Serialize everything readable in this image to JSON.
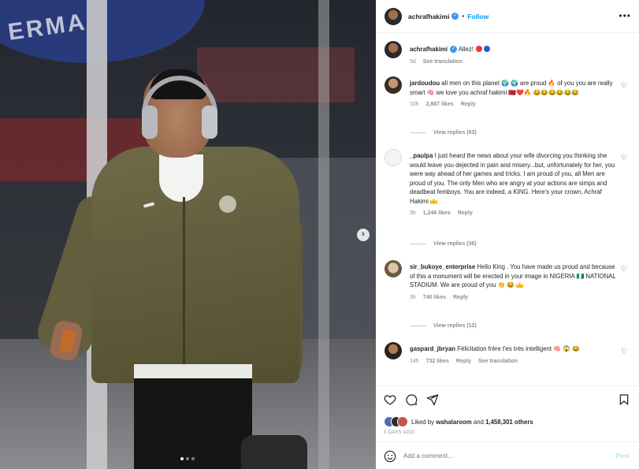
{
  "post": {
    "username": "achrafhakimi",
    "follow_label": "Follow",
    "more_label": "•••",
    "caption_user": "achrafhakimi",
    "caption_text": "Allez!",
    "caption_time": "5d",
    "caption_translate": "See translation"
  },
  "comments": [
    {
      "user": "jardoudou",
      "text": "all men on this planet 🌍 🌍 are proud 🔥 of you you are really smart 🧠 we love you achraf hakimi 🇲🇦❤️🔥 😂😂😂😂😂😂",
      "time": "10h",
      "likes": "2,887 likes",
      "reply": "Reply",
      "view_replies": "View replies (63)"
    },
    {
      "user": "_paulpa",
      "text": "I just heard the news about your wife divorcing you thinking she would leave you dejected in pain and misery...but, unfortunately for her, you were way ahead of her games and tricks. I am proud of you, all Men are proud of you. The only Men who are angry at your actions are simps and deadbeat femboys. You are indeed, a KING. Here's your crown, Achraf Hakimi",
      "time": "3h",
      "likes": "1,246 likes",
      "reply": "Reply",
      "view_replies": "View replies (36)"
    },
    {
      "user": "sir_bukoye_enterprise",
      "text": "Hello King . You have made us proud and because of this a monument will be erected in your image in NIGERIA 🇳🇬 NATIONAL STADIUM. We are proud of you 👏 😂",
      "time": "3h",
      "likes": "740 likes",
      "reply": "Reply",
      "view_replies": "View replies (12)"
    },
    {
      "user": "gaspard_jbryan",
      "text": "Félicitation frère t'es très intelligent 🧠 😱 😂",
      "time": "14h",
      "likes": "732 likes",
      "reply": "Reply",
      "translate": "See translation"
    }
  ],
  "footer": {
    "liked_by_prefix": "Liked by",
    "liked_by_user": "wahalaroom",
    "liked_by_suffix": "and",
    "likes_count": "1,458,301 others",
    "date": "5 DAYS AGO",
    "add_comment_placeholder": "Add a comment...",
    "post_label": "Post"
  },
  "icons": {
    "like": "heart-icon",
    "comment": "comment-icon",
    "share": "share-icon",
    "save": "bookmark-icon",
    "emoji": "smiley-icon",
    "next": "chevron-right-icon"
  },
  "colors": {
    "link": "#0095f6",
    "muted": "#8e8e8e",
    "verified": "#3897f0"
  },
  "carousel": {
    "current": 1,
    "total": 3
  }
}
